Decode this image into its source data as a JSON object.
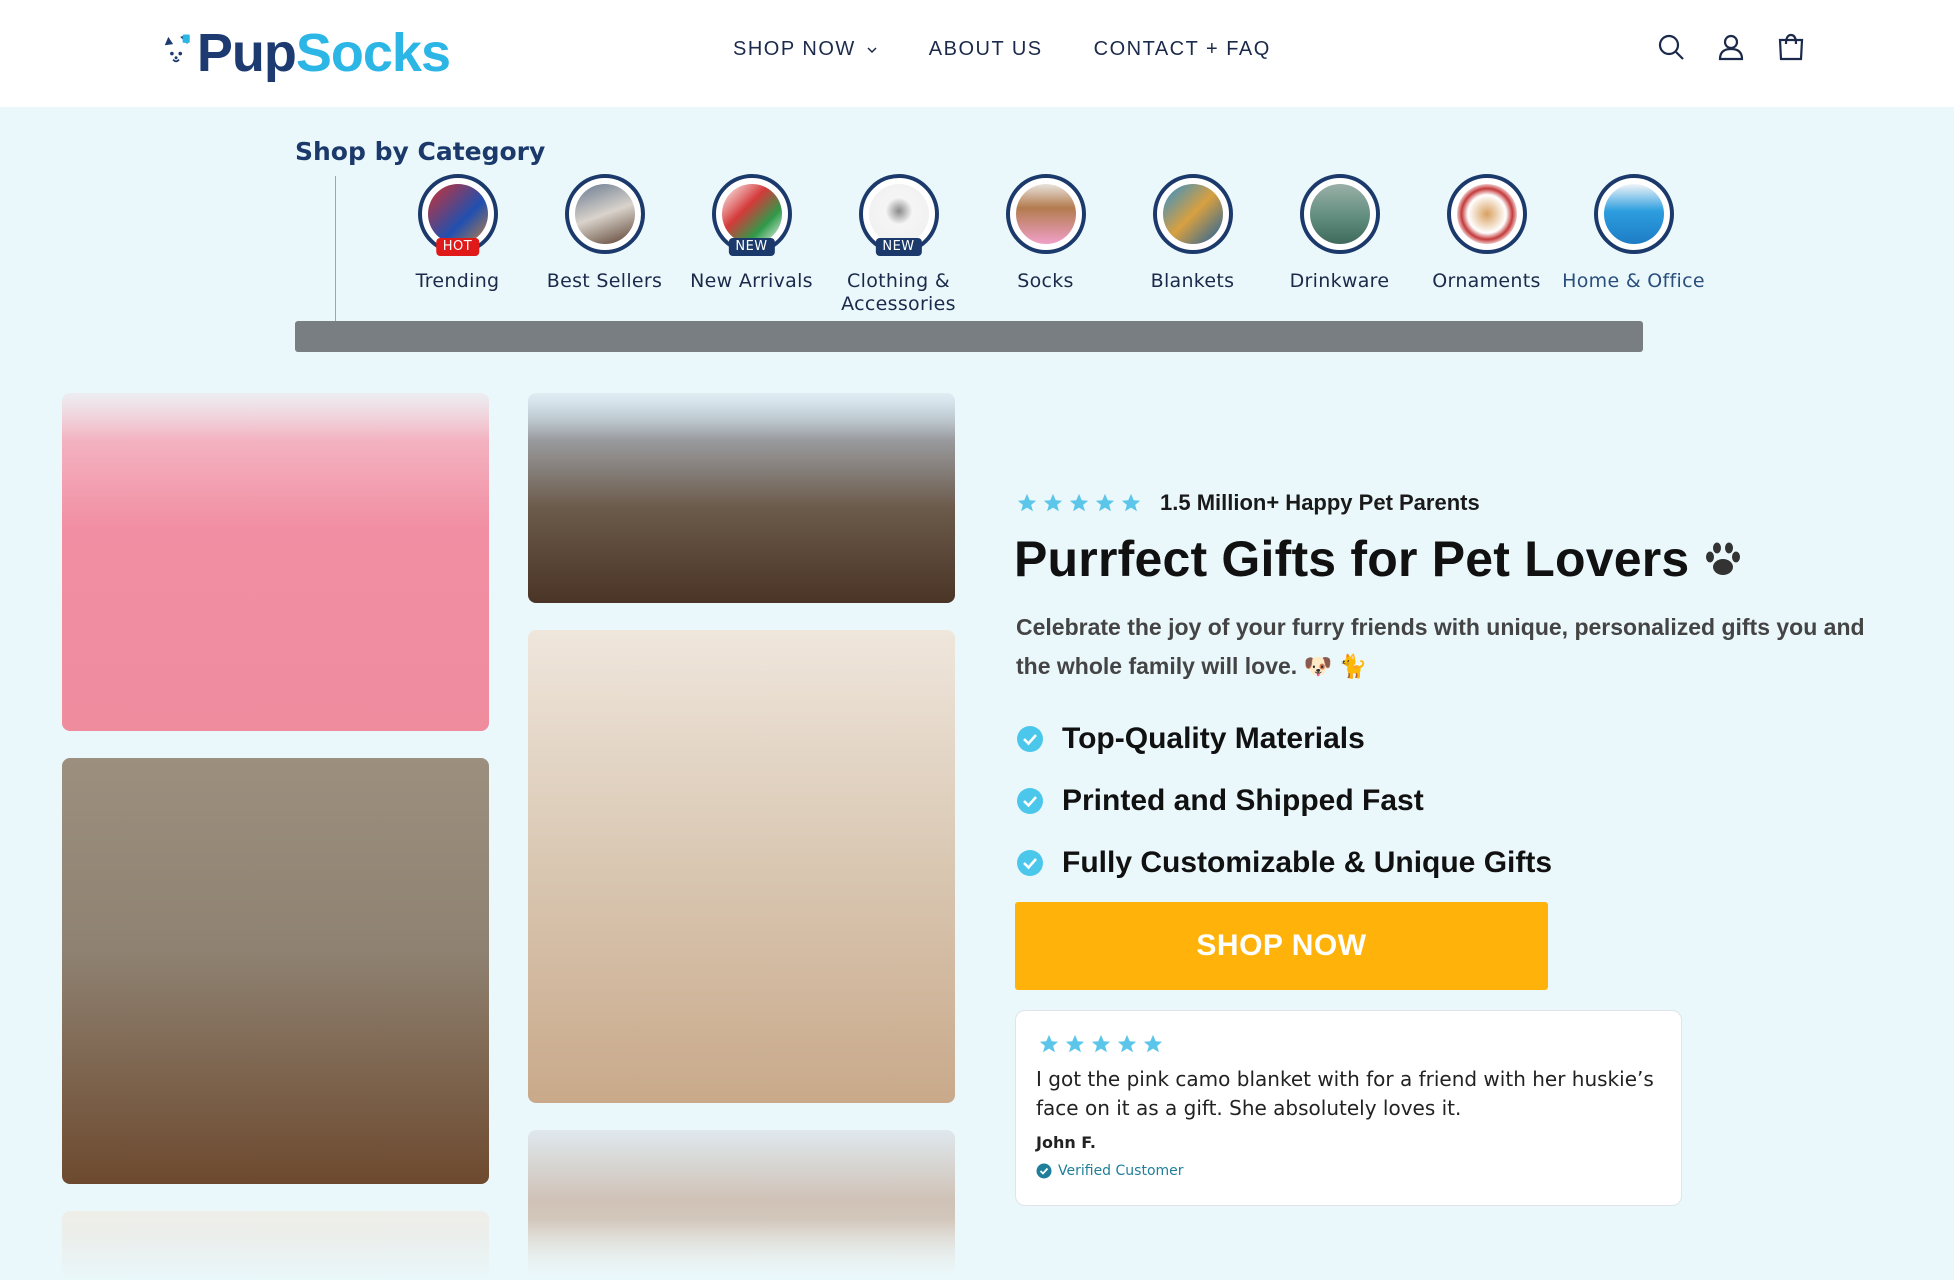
{
  "brand": {
    "name_part1": "Pup",
    "name_part2": "Socks"
  },
  "nav": {
    "items": [
      {
        "label": "SHOP NOW",
        "has_dropdown": true
      },
      {
        "label": "ABOUT US",
        "has_dropdown": false
      },
      {
        "label": "CONTACT + FAQ",
        "has_dropdown": false
      }
    ]
  },
  "header_icons": [
    "search-icon",
    "account-icon",
    "cart-icon"
  ],
  "categories": {
    "title": "Shop by Category",
    "items": [
      {
        "label": "Trending",
        "badge": "HOT"
      },
      {
        "label": "Best Sellers",
        "badge": ""
      },
      {
        "label": "New Arrivals",
        "badge": "NEW"
      },
      {
        "label": "Clothing & Accessories",
        "badge": "NEW"
      },
      {
        "label": "Socks",
        "badge": ""
      },
      {
        "label": "Blankets",
        "badge": ""
      },
      {
        "label": "Drinkware",
        "badge": ""
      },
      {
        "label": "Ornaments",
        "badge": ""
      },
      {
        "label": "Home & Office",
        "badge": ""
      }
    ]
  },
  "hero": {
    "social_proof": "1.5 Million+ Happy Pet Parents",
    "rating_stars": 5,
    "title": "Purrfect Gifts for Pet Lovers",
    "subtitle": "Celebrate the joy of your furry friends with unique, personalized gifts you and the whole family will love. 🐶 🐈",
    "features": [
      "Top-Quality Materials",
      "Printed and Shipped Fast",
      "Fully Customizable & Unique Gifts"
    ],
    "cta_label": "SHOP NOW"
  },
  "review": {
    "stars": 5,
    "text": "I got the pink camo blanket with for a friend with her huskie’s face on it as a gift. She absolutely loves it.",
    "author": "John F.",
    "verified_label": "Verified Customer"
  },
  "colors": {
    "navy": "#1b3a6b",
    "brand_blue": "#2cb6e6",
    "cta_yellow": "#ffb30a",
    "page_bg": "#eaf8fb",
    "hot_badge": "#e01919"
  }
}
